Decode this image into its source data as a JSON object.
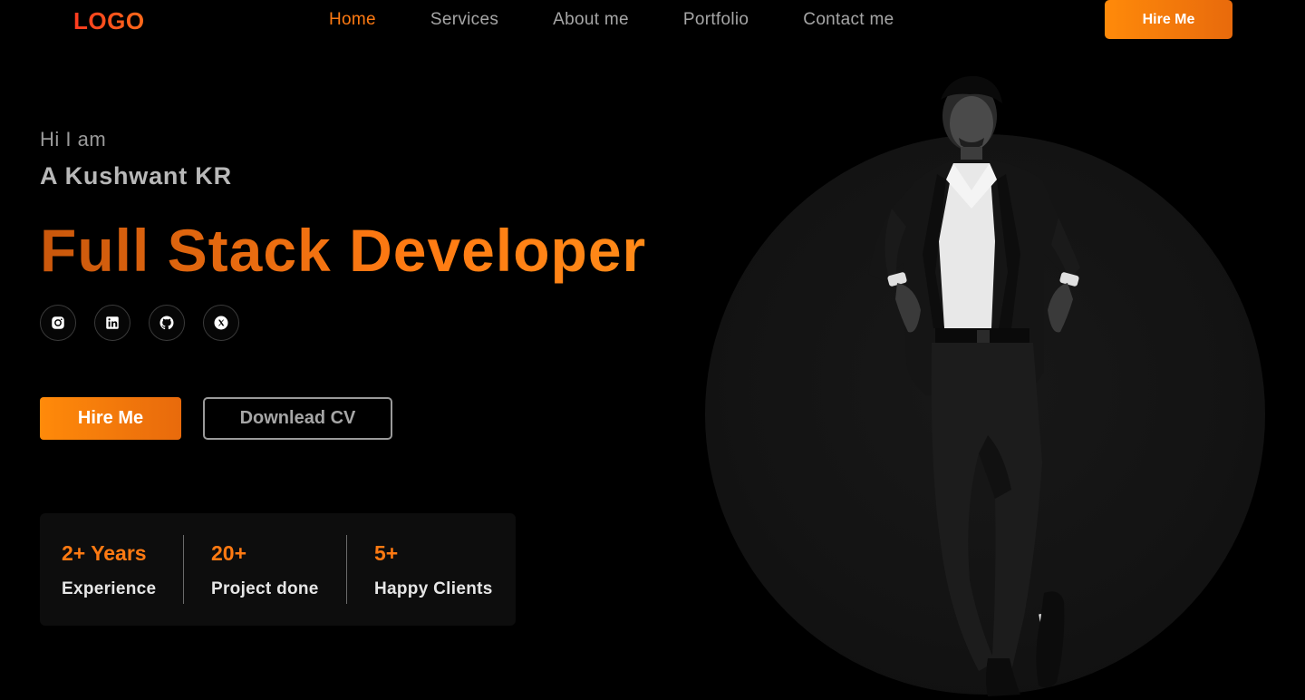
{
  "header": {
    "logo": "LOGO",
    "nav": [
      {
        "label": "Home",
        "active": true
      },
      {
        "label": "Services",
        "active": false
      },
      {
        "label": "About me",
        "active": false
      },
      {
        "label": "Portfolio",
        "active": false
      },
      {
        "label": "Contact me",
        "active": false
      }
    ],
    "hire_label": "Hire Me"
  },
  "hero": {
    "greeting": "Hi I am",
    "name": "A Kushwant KR",
    "role": "Full Stack Developer",
    "socials": [
      {
        "icon": "instagram-icon"
      },
      {
        "icon": "linkedin-icon"
      },
      {
        "icon": "github-icon"
      },
      {
        "icon": "x-icon"
      }
    ],
    "hire_label": "Hire Me",
    "cv_label": "Downlead CV"
  },
  "stats": [
    {
      "value": "2+ Years",
      "label": "Experience"
    },
    {
      "value": "20+",
      "label": "Project done"
    },
    {
      "value": "5+",
      "label": "Happy Clients"
    }
  ],
  "colors": {
    "accent": "#ff7a12",
    "logo": "#ff3b1f",
    "background": "#000000"
  }
}
